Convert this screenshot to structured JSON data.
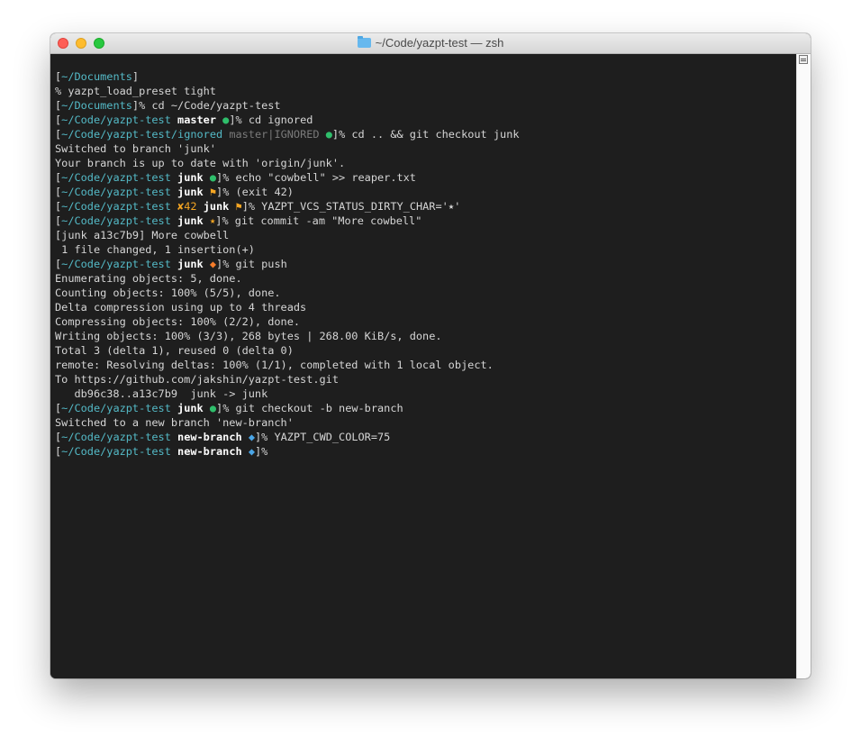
{
  "window": {
    "title": "~/Code/yazpt-test — zsh",
    "icon": "folder-icon",
    "colors": {
      "background": "#1e1e1e",
      "text": "#d6d6d6",
      "cwd": "#54bac7",
      "clean": "#2fbe6b",
      "dirty": "#f5a623",
      "ahead": "#f57c2a",
      "branch_new": "#4aa5e6"
    }
  },
  "terminal": {
    "lines": [
      {
        "segs": [
          [
            "[",
            ""
          ],
          [
            "~/Documents",
            "cwd"
          ],
          [
            "]",
            ""
          ]
        ]
      },
      {
        "segs": [
          [
            "% yazpt_load_preset tight",
            ""
          ]
        ]
      },
      {
        "segs": [
          [
            "[",
            ""
          ],
          [
            "~/Documents",
            "cwd"
          ],
          [
            "]% cd ~/Code/yazpt-test",
            ""
          ]
        ]
      },
      {
        "segs": [
          [
            "[",
            ""
          ],
          [
            "~/Code/yazpt-test",
            "cwd"
          ],
          [
            " ",
            ""
          ],
          [
            "master",
            "br"
          ],
          [
            " ",
            ""
          ],
          [
            "●",
            "g"
          ],
          [
            "]% cd ignored",
            ""
          ]
        ]
      },
      {
        "segs": [
          [
            "[",
            ""
          ],
          [
            "~/Code/yazpt-test/ignored",
            "cwd"
          ],
          [
            " ",
            ""
          ],
          [
            "master|IGNORED",
            "ign"
          ],
          [
            " ",
            ""
          ],
          [
            "●",
            "g"
          ],
          [
            "]% cd .. && git checkout junk",
            ""
          ]
        ]
      },
      {
        "segs": [
          [
            "Switched to branch 'junk'",
            ""
          ]
        ]
      },
      {
        "segs": [
          [
            "Your branch is up to date with 'origin/junk'.",
            ""
          ]
        ]
      },
      {
        "segs": [
          [
            "[",
            ""
          ],
          [
            "~/Code/yazpt-test",
            "cwd"
          ],
          [
            " ",
            ""
          ],
          [
            "junk",
            "br"
          ],
          [
            " ",
            ""
          ],
          [
            "●",
            "g"
          ],
          [
            "]% echo \"cowbell\" >> reaper.txt",
            ""
          ]
        ]
      },
      {
        "segs": [
          [
            "[",
            ""
          ],
          [
            "~/Code/yazpt-test",
            "cwd"
          ],
          [
            " ",
            ""
          ],
          [
            "junk",
            "br"
          ],
          [
            " ",
            ""
          ],
          [
            "⚑",
            "o"
          ],
          [
            "]% (exit 42)",
            ""
          ]
        ]
      },
      {
        "segs": [
          [
            "[",
            ""
          ],
          [
            "~/Code/yazpt-test",
            "cwd"
          ],
          [
            " ",
            ""
          ],
          [
            "✘42",
            "o"
          ],
          [
            " ",
            ""
          ],
          [
            "junk",
            "br"
          ],
          [
            " ",
            ""
          ],
          [
            "⚑",
            "o"
          ],
          [
            "]% YAZPT_VCS_STATUS_DIRTY_CHAR='⭑'",
            ""
          ]
        ]
      },
      {
        "segs": [
          [
            "[",
            ""
          ],
          [
            "~/Code/yazpt-test",
            "cwd"
          ],
          [
            " ",
            ""
          ],
          [
            "junk",
            "br"
          ],
          [
            " ",
            ""
          ],
          [
            "⭑",
            "o"
          ],
          [
            "]% git commit -am \"More cowbell\"",
            ""
          ]
        ]
      },
      {
        "segs": [
          [
            "[junk a13c7b9] More cowbell",
            ""
          ]
        ]
      },
      {
        "segs": [
          [
            " 1 file changed, 1 insertion(+)",
            ""
          ]
        ]
      },
      {
        "segs": [
          [
            "[",
            ""
          ],
          [
            "~/Code/yazpt-test",
            "cwd"
          ],
          [
            " ",
            ""
          ],
          [
            "junk",
            "br"
          ],
          [
            " ",
            ""
          ],
          [
            "◆",
            "ch"
          ],
          [
            "]% git push",
            ""
          ]
        ]
      },
      {
        "segs": [
          [
            "Enumerating objects: 5, done.",
            ""
          ]
        ]
      },
      {
        "segs": [
          [
            "Counting objects: 100% (5/5), done.",
            ""
          ]
        ]
      },
      {
        "segs": [
          [
            "Delta compression using up to 4 threads",
            ""
          ]
        ]
      },
      {
        "segs": [
          [
            "Compressing objects: 100% (2/2), done.",
            ""
          ]
        ]
      },
      {
        "segs": [
          [
            "Writing objects: 100% (3/3), 268 bytes | 268.00 KiB/s, done.",
            ""
          ]
        ]
      },
      {
        "segs": [
          [
            "Total 3 (delta 1), reused 0 (delta 0)",
            ""
          ]
        ]
      },
      {
        "segs": [
          [
            "remote: Resolving deltas: 100% (1/1), completed with 1 local object.",
            ""
          ]
        ]
      },
      {
        "segs": [
          [
            "To https://github.com/jakshin/yazpt-test.git",
            ""
          ]
        ]
      },
      {
        "segs": [
          [
            "   db96c38..a13c7b9  junk -> junk",
            ""
          ]
        ]
      },
      {
        "segs": [
          [
            "[",
            ""
          ],
          [
            "~/Code/yazpt-test",
            "cwd"
          ],
          [
            " ",
            ""
          ],
          [
            "junk",
            "br"
          ],
          [
            " ",
            ""
          ],
          [
            "●",
            "g"
          ],
          [
            "]% git checkout -b new-branch",
            ""
          ]
        ]
      },
      {
        "segs": [
          [
            "Switched to a new branch 'new-branch'",
            ""
          ]
        ]
      },
      {
        "segs": [
          [
            "[",
            ""
          ],
          [
            "~/Code/yazpt-test",
            "cwd"
          ],
          [
            " ",
            ""
          ],
          [
            "new-branch",
            "br"
          ],
          [
            " ",
            ""
          ],
          [
            "◆",
            "bl"
          ],
          [
            "]% YAZPT_CWD_COLOR=75",
            ""
          ]
        ]
      },
      {
        "segs": [
          [
            "[",
            ""
          ],
          [
            "~/Code/yazpt-test",
            "cwd"
          ],
          [
            " ",
            ""
          ],
          [
            "new-branch",
            "br"
          ],
          [
            " ",
            ""
          ],
          [
            "◆",
            "bl"
          ],
          [
            "]%",
            ""
          ]
        ]
      }
    ]
  }
}
